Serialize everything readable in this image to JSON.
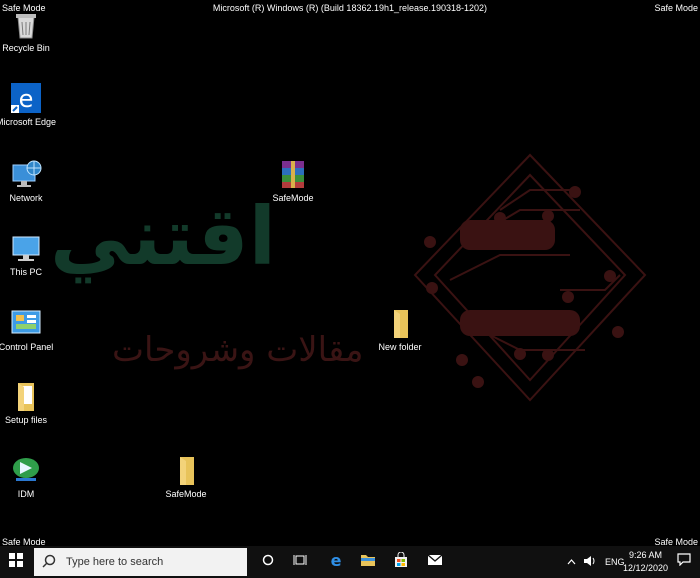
{
  "overlay": {
    "safe_mode_label": "Safe Mode",
    "build_string": "Microsoft (R) Windows (R) (Build 18362.19h1_release.190318-1202)"
  },
  "desktop": {
    "icons": [
      {
        "label": "Recycle Bin",
        "icon": "recycle-bin-icon"
      },
      {
        "label": "Microsoft Edge",
        "icon": "edge-icon"
      },
      {
        "label": "Network",
        "icon": "network-icon"
      },
      {
        "label": "This PC",
        "icon": "computer-icon"
      },
      {
        "label": "Control Panel",
        "icon": "control-panel-icon"
      },
      {
        "label": "Setup files",
        "icon": "folder-icon"
      },
      {
        "label": "IDM",
        "icon": "idm-icon"
      },
      {
        "label": "SafeMode",
        "icon": "winrar-archive-icon"
      },
      {
        "label": "New folder",
        "icon": "folder-icon"
      },
      {
        "label": "SafeMode",
        "icon": "folder-icon"
      }
    ]
  },
  "watermark": {
    "title_ar": "اقتني",
    "subtitle_ar": "مقالات وشروحات"
  },
  "taskbar": {
    "search_placeholder": "Type here to search",
    "language": "ENG",
    "time": "9:26 AM",
    "date": "12/12/2020"
  },
  "colors": {
    "background": "#000000",
    "taskbar": "#101010",
    "accent": "#0078d7",
    "folder": "#e8c35a"
  }
}
